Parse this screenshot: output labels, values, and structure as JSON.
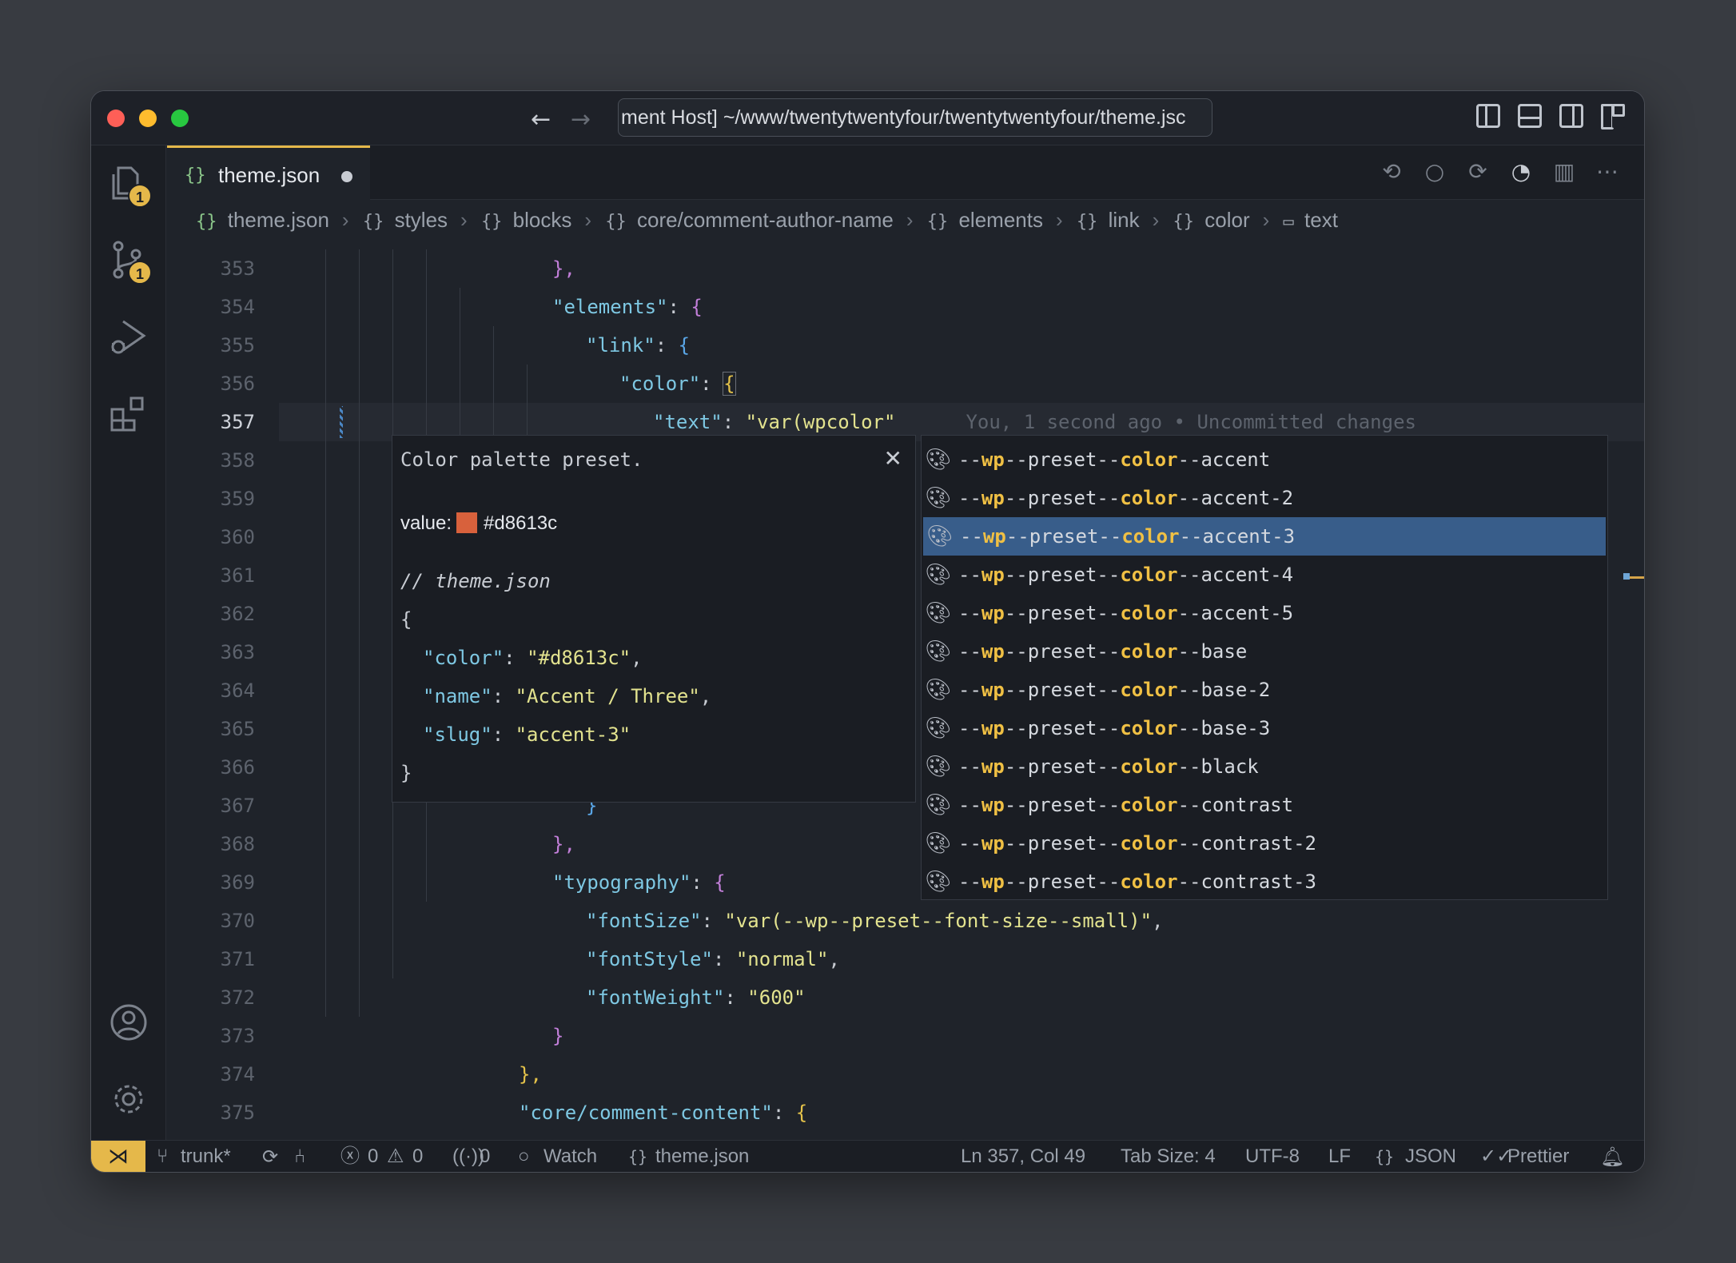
{
  "window": {
    "title": "ment Host] ~/www/twentytwentyfour/twentytwentyfour/theme.jsc"
  },
  "activity_bar": {
    "explorer_badge": "1",
    "scm_badge": "1"
  },
  "tab": {
    "name": "theme.json"
  },
  "breadcrumbs": [
    "theme.json",
    "styles",
    "blocks",
    "core/comment-author-name",
    "elements",
    "link",
    "color",
    "text"
  ],
  "code": {
    "line_numbers": [
      "353",
      "354",
      "355",
      "356",
      "357",
      "358",
      "359",
      "360",
      "361",
      "362",
      "363",
      "364",
      "365",
      "366",
      "367",
      "368",
      "369",
      "370",
      "371",
      "372",
      "373",
      "374",
      "375"
    ],
    "l353": "},",
    "l354_key": "\"elements\"",
    "l355_key": "\"link\"",
    "l356_key": "\"color\"",
    "l357_key": "\"text\"",
    "l357_val": "\"var(wpcolor\"",
    "blame": "You, 1 second ago • Uncommitted changes",
    "l367": "}",
    "l368": "},",
    "l369_key": "\"typography\"",
    "l370_key": "\"fontSize\"",
    "l370_val": "\"var(--wp--preset--font-size--small)\"",
    "l371_key": "\"fontStyle\"",
    "l371_val": "\"normal\"",
    "l372_key": "\"fontWeight\"",
    "l372_val": "\"600\"",
    "l373": "}",
    "l374": "},",
    "l375_key": "\"core/comment-content\""
  },
  "hover": {
    "title": "Color palette preset.",
    "value_label": "value:",
    "value": "#d8613c",
    "swatch_color": "#d8613c",
    "comment": "// theme.json",
    "open": "{",
    "color_key": "\"color\"",
    "color_val": "\"#d8613c\"",
    "name_key": "\"name\"",
    "name_val": "\"Accent / Three\"",
    "slug_key": "\"slug\"",
    "slug_val": "\"accent-3\"",
    "close": "}"
  },
  "suggestions": [
    {
      "suffix": "accent"
    },
    {
      "suffix": "accent-2"
    },
    {
      "suffix": "accent-3",
      "selected": true
    },
    {
      "suffix": "accent-4"
    },
    {
      "suffix": "accent-5"
    },
    {
      "suffix": "base"
    },
    {
      "suffix": "base-2"
    },
    {
      "suffix": "base-3"
    },
    {
      "suffix": "black"
    },
    {
      "suffix": "contrast"
    },
    {
      "suffix": "contrast-2"
    },
    {
      "suffix": "contrast-3"
    }
  ],
  "status": {
    "branch": "trunk*",
    "errors": "0",
    "warnings": "0",
    "ports": "0",
    "watch": "Watch",
    "file": "theme.json",
    "position": "Ln 357, Col 49",
    "tab_size": "Tab Size: 4",
    "encoding": "UTF-8",
    "eol": "LF",
    "language": "JSON",
    "formatter": "Prettier"
  },
  "colors": {
    "accent": "#e5b84a",
    "selection": "#385d8a"
  }
}
